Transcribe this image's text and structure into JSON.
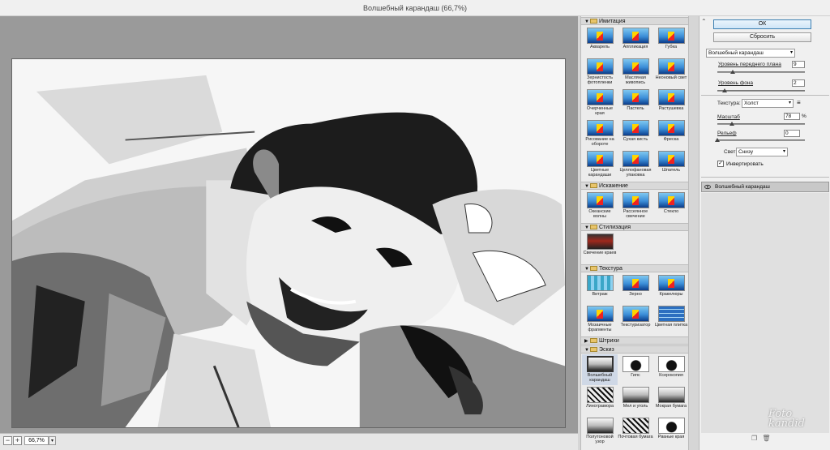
{
  "window": {
    "title": "Волшебный карандаш (66,7%)"
  },
  "status": {
    "zoom": "66,7%"
  },
  "gallery": {
    "categories": [
      {
        "name": "Имитация",
        "expanded": true,
        "filters": [
          {
            "label": "Акварель",
            "thumb": "sea"
          },
          {
            "label": "Аппликация",
            "thumb": "sea"
          },
          {
            "label": "Губка",
            "thumb": "sea"
          },
          {
            "label": "Зернистость фотопленки",
            "thumb": "sea"
          },
          {
            "label": "Масляная живопись",
            "thumb": "sea"
          },
          {
            "label": "Неоновый свет",
            "thumb": "sea"
          },
          {
            "label": "Очерченные края",
            "thumb": "sea"
          },
          {
            "label": "Пастель",
            "thumb": "sea"
          },
          {
            "label": "Растушевка",
            "thumb": "sea"
          },
          {
            "label": "Рисование на обороте",
            "thumb": "sea"
          },
          {
            "label": "Сухая кисть",
            "thumb": "sea"
          },
          {
            "label": "Фреска",
            "thumb": "sea"
          },
          {
            "label": "Цветные карандаши",
            "thumb": "sea"
          },
          {
            "label": "Целлофановая упаковка",
            "thumb": "sea"
          },
          {
            "label": "Шпатель",
            "thumb": "sea"
          }
        ]
      },
      {
        "name": "Искажение",
        "expanded": true,
        "filters": [
          {
            "label": "Океанские волны",
            "thumb": "sea"
          },
          {
            "label": "Рассеянное свечение",
            "thumb": "sea"
          },
          {
            "label": "Стекло",
            "thumb": "sea"
          }
        ]
      },
      {
        "name": "Стилизация",
        "expanded": true,
        "filters": [
          {
            "label": "Свечение краев",
            "thumb": "dark"
          }
        ]
      },
      {
        "name": "Текстура",
        "expanded": true,
        "filters": [
          {
            "label": "Витраж",
            "thumb": "mosaic"
          },
          {
            "label": "Зерно",
            "thumb": "sea"
          },
          {
            "label": "Кракелюры",
            "thumb": "sea"
          },
          {
            "label": "Мозаичные фрагменты",
            "thumb": "sea"
          },
          {
            "label": "Текстуризатор",
            "thumb": "sea"
          },
          {
            "label": "Цветная плитка",
            "thumb": "tile"
          }
        ]
      },
      {
        "name": "Штрихи",
        "expanded": false,
        "filters": []
      },
      {
        "name": "Эскиз",
        "expanded": true,
        "filters": [
          {
            "label": "Волшебный карандаш",
            "thumb": "sketch",
            "selected": true
          },
          {
            "label": "Гипс",
            "thumb": "bw"
          },
          {
            "label": "Ксерокопия",
            "thumb": "bw"
          },
          {
            "label": "Линогравюра",
            "thumb": "sketch2"
          },
          {
            "label": "Мел и уголь",
            "thumb": "sketch"
          },
          {
            "label": "Мокрая бумага",
            "thumb": "sketch"
          },
          {
            "label": "Полутоновой узор",
            "thumb": "sketch"
          },
          {
            "label": "Почтовая бумага",
            "thumb": "sketch2"
          },
          {
            "label": "Рваные края",
            "thumb": "bw"
          }
        ]
      }
    ]
  },
  "settings": {
    "ok_label": "ОК",
    "reset_label": "Сбросить",
    "filter_select": "Волшебный карандаш",
    "foreground_label": "Уровень переднего плана",
    "foreground_value": "9",
    "foreground_level": 0.18,
    "background_label": "Уровень фона",
    "background_value": "2",
    "background_level": 0.08,
    "texture_label": "Текстура:",
    "texture_value": "Холст",
    "scale_label": "Масштаб",
    "scale_value": "78",
    "scale_unit": "%",
    "scale_level": 0.17,
    "relief_label": "Рельеф",
    "relief_value": "0",
    "relief_level": 0.0,
    "light_label": "Свет:",
    "light_value": "Снизу",
    "invert_label": "Инвертировать",
    "invert_checked": true
  },
  "layers": [
    {
      "name": "Волшебный карандаш",
      "visible": true
    }
  ],
  "watermark": {
    "line1": "Foto",
    "line2": "kandid"
  }
}
